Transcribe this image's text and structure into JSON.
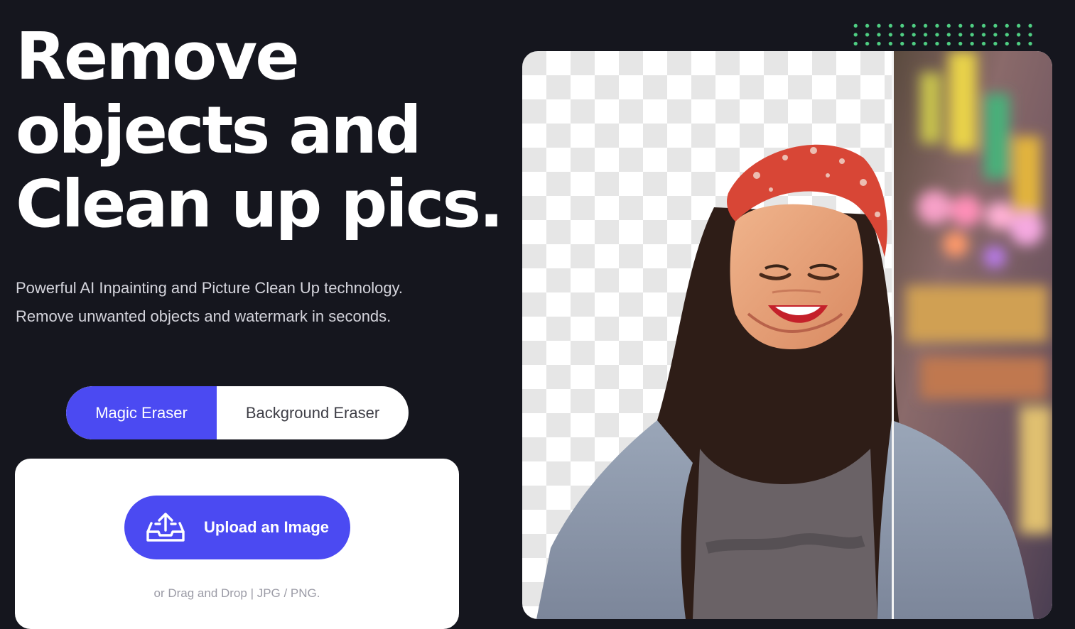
{
  "hero": {
    "title_line1": "Remove",
    "title_line2": "objects and",
    "title_line3": "Clean up pics.",
    "subtitle_line1": "Powerful AI Inpainting and Picture Clean Up technology.",
    "subtitle_line2": "Remove unwanted objects and watermark in seconds."
  },
  "mode_toggle": {
    "options": [
      "Magic Eraser",
      "Background Eraser"
    ],
    "selected": "Magic Eraser"
  },
  "upload": {
    "button_label": "Upload an Image",
    "icon": "upload-tray-icon",
    "hint": "or Drag and Drop | JPG / PNG."
  },
  "preview": {
    "left_state": "transparent-background",
    "right_state": "original-photo"
  },
  "colors": {
    "background": "#15161e",
    "accent": "#4b4af2",
    "dots": "#4fcf83",
    "card": "#ffffff"
  }
}
